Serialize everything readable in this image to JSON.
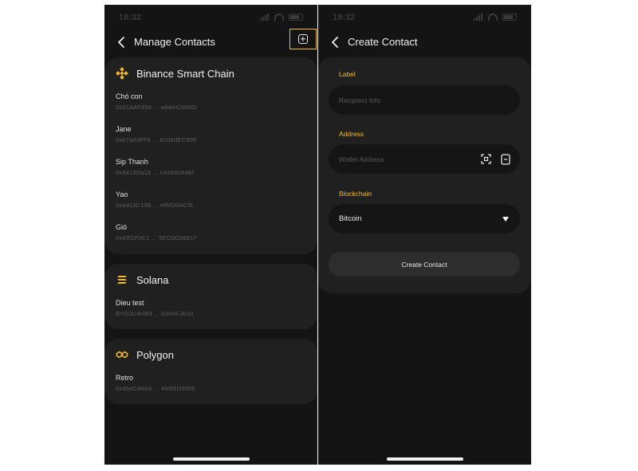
{
  "status_bar": {
    "time": "18:32"
  },
  "manage": {
    "title": "Manage Contacts",
    "groups": [
      {
        "chain": "Binance Smart Chain",
        "icon": "binance-icon",
        "contacts": [
          {
            "name": "Chó con",
            "address": "0x01AAF65e ... a6a942686D"
          },
          {
            "name": "Jane",
            "address": "0x67a43FFb ... 8108dEC909"
          },
          {
            "name": "Sip Thanh",
            "address": "0x9413Da1b ... c44680A4bf"
          },
          {
            "name": "Yao",
            "address": "0xbd13C156 ... ef66364Cf0"
          },
          {
            "name": "Gió",
            "address": "0x43f1F0C1 ... 5ED0O58817"
          }
        ]
      },
      {
        "chain": "Solana",
        "icon": "solana-icon",
        "contacts": [
          {
            "name": "Dieu test",
            "address": "BVG0U4HB3 ... b3nhKJkvD"
          }
        ]
      },
      {
        "chain": "Polygon",
        "icon": "polygon-icon",
        "contacts": [
          {
            "name": "Retro",
            "address": "0xd6eC48A9 ... 4fe95D5005"
          }
        ]
      }
    ]
  },
  "create": {
    "title": "Create Contact",
    "label_field": {
      "label": "Label",
      "placeholder": "Recipient Info"
    },
    "address_field": {
      "label": "Address",
      "placeholder": "Wallet Address"
    },
    "blockchain_field": {
      "label": "Blockchain",
      "value": "Bitcoin"
    },
    "submit_label": "Create Contact"
  },
  "colors": {
    "accent": "#f3ba2f",
    "background": "#141414",
    "card": "#202020",
    "field": "#151515"
  }
}
